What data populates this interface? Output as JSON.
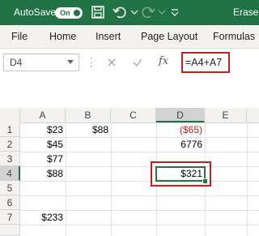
{
  "title_bar": {
    "autosave_label": "AutoSave",
    "autosave_toggle": "On",
    "filename": "Erase",
    "icons": [
      "save-icon",
      "undo-icon",
      "redo-icon",
      "customize-qat-icon"
    ],
    "bg_color": "#217346"
  },
  "ribbon": {
    "tabs": [
      "File",
      "Home",
      "Insert",
      "Page Layout",
      "Formulas"
    ]
  },
  "formula_bar": {
    "name_box": "D4",
    "fx_label": "fx",
    "formula": "=A4+A7",
    "highlight_color": "#c0201f"
  },
  "grid": {
    "columns": [
      "A",
      "B",
      "C",
      "D",
      "E"
    ],
    "rows": [
      "1",
      "2",
      "3",
      "4",
      "5",
      "6",
      "7"
    ],
    "cells": {
      "A1": "$23",
      "B1": "$88",
      "D1": "($65)",
      "A2": "$45",
      "D2": "6776",
      "A3": "$77",
      "A4": "$88",
      "D4": "$321",
      "A7": "$233"
    },
    "negative_color": "#c0201f",
    "active_cell": "D4",
    "accent_color": "#217346"
  }
}
